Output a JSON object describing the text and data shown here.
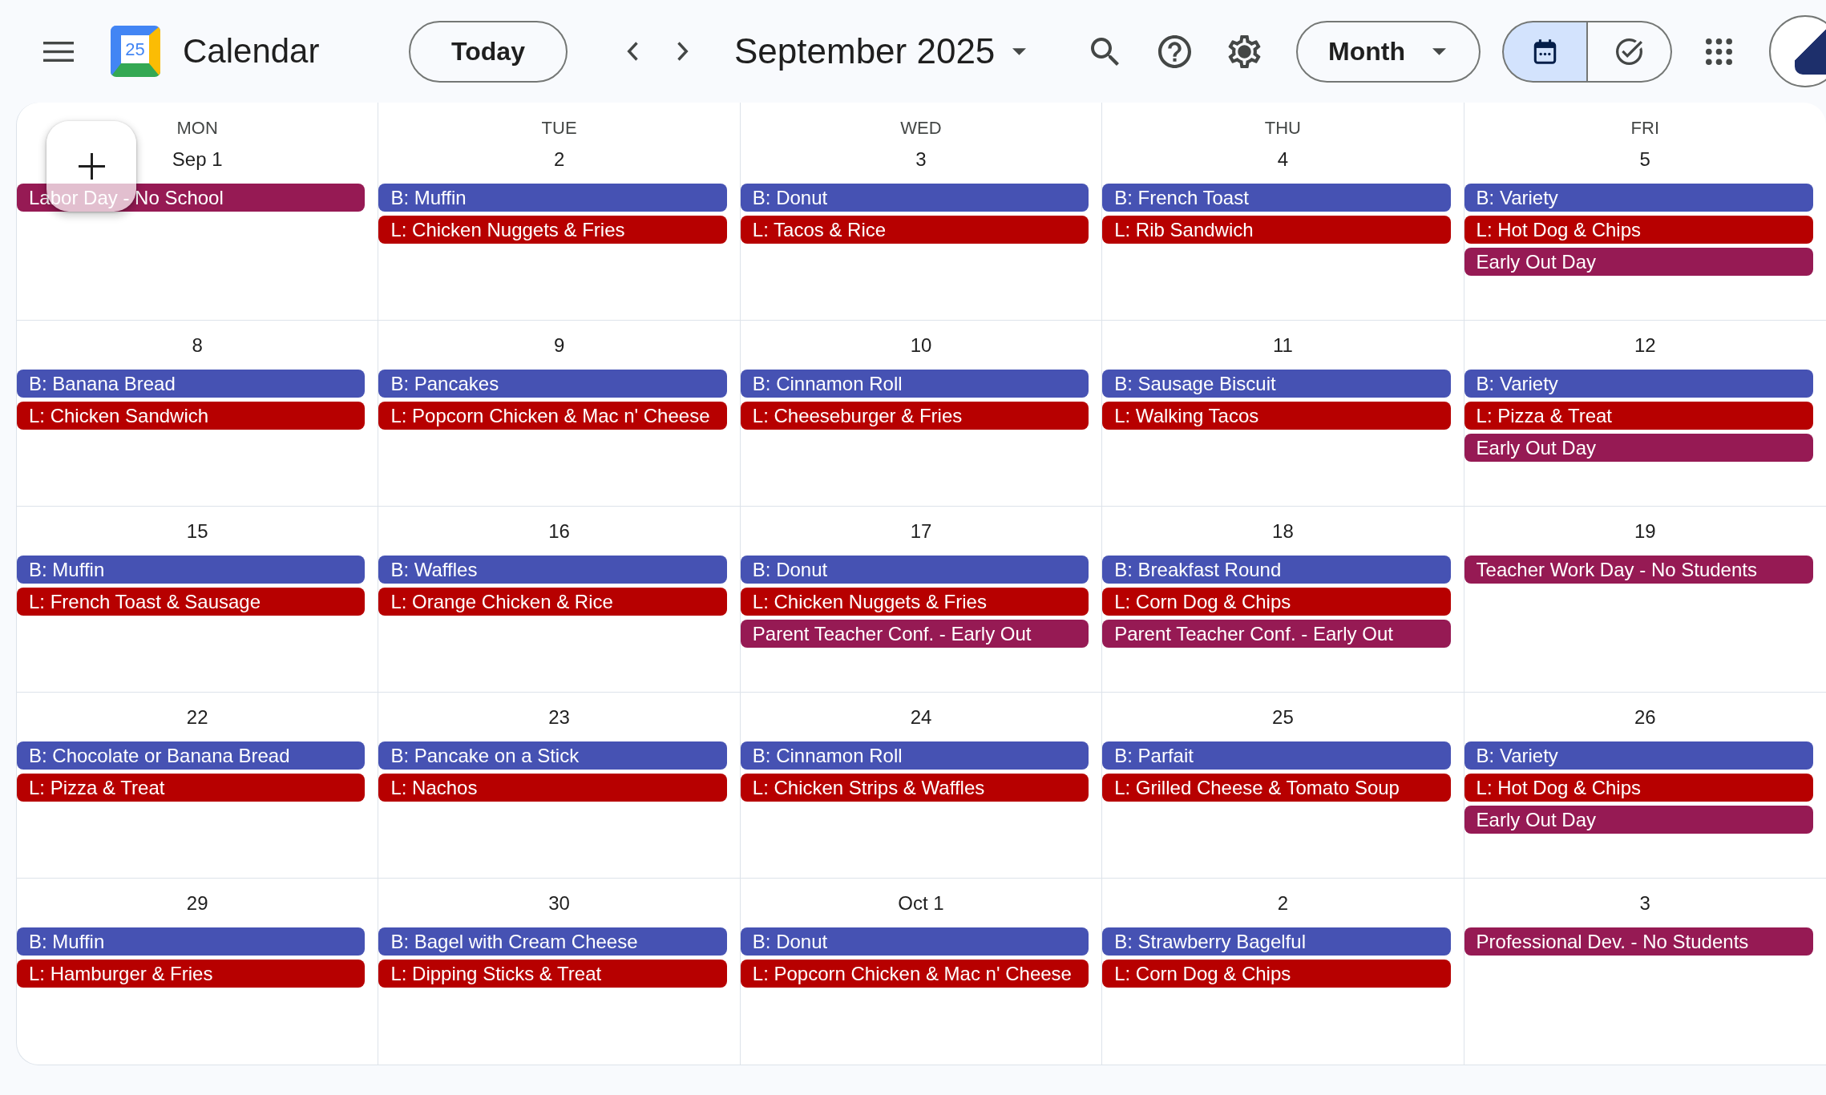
{
  "app": {
    "logo_text": "25",
    "title": "Calendar"
  },
  "toolbar": {
    "today_button": "Today",
    "period": "September 2025",
    "view_selector": "Month",
    "view_toggle": [
      {
        "kind": "calendar",
        "selected": true
      },
      {
        "kind": "tasks",
        "selected": false
      }
    ]
  },
  "weekdays": [
    "MON",
    "TUE",
    "WED",
    "THU",
    "FRI"
  ],
  "weeks": [
    {
      "days": [
        {
          "date": "Sep 1",
          "events": [
            {
              "title": "Labor Day - No School",
              "color": "#961a54"
            }
          ]
        },
        {
          "date": "2",
          "events": [
            {
              "title": "B: Muffin",
              "color": "#4652b3"
            },
            {
              "title": "L: Chicken Nuggets & Fries",
              "color": "#b70000"
            }
          ]
        },
        {
          "date": "3",
          "events": [
            {
              "title": "B: Donut",
              "color": "#4652b3"
            },
            {
              "title": "L: Tacos & Rice",
              "color": "#b70000"
            }
          ]
        },
        {
          "date": "4",
          "events": [
            {
              "title": "B: French Toast",
              "color": "#4652b3"
            },
            {
              "title": "L: Rib Sandwich",
              "color": "#b70000"
            }
          ]
        },
        {
          "date": "5",
          "events": [
            {
              "title": "B: Variety",
              "color": "#4652b3"
            },
            {
              "title": "L: Hot Dog & Chips",
              "color": "#b70000"
            },
            {
              "title": "Early Out Day",
              "color": "#961a54"
            }
          ]
        }
      ]
    },
    {
      "days": [
        {
          "date": "8",
          "events": [
            {
              "title": "B: Banana Bread",
              "color": "#4652b3"
            },
            {
              "title": "L: Chicken Sandwich",
              "color": "#b70000"
            }
          ]
        },
        {
          "date": "9",
          "events": [
            {
              "title": "B: Pancakes",
              "color": "#4652b3"
            },
            {
              "title": "L: Popcorn Chicken & Mac n' Cheese",
              "color": "#b70000"
            }
          ]
        },
        {
          "date": "10",
          "events": [
            {
              "title": "B: Cinnamon Roll",
              "color": "#4652b3"
            },
            {
              "title": "L: Cheeseburger & Fries",
              "color": "#b70000"
            }
          ]
        },
        {
          "date": "11",
          "events": [
            {
              "title": "B: Sausage Biscuit",
              "color": "#4652b3"
            },
            {
              "title": "L: Walking Tacos",
              "color": "#b70000"
            }
          ]
        },
        {
          "date": "12",
          "events": [
            {
              "title": "B: Variety",
              "color": "#4652b3"
            },
            {
              "title": "L: Pizza & Treat",
              "color": "#b70000"
            },
            {
              "title": "Early Out Day",
              "color": "#961a54"
            }
          ]
        }
      ]
    },
    {
      "days": [
        {
          "date": "15",
          "events": [
            {
              "title": "B: Muffin",
              "color": "#4652b3"
            },
            {
              "title": "L: French Toast & Sausage",
              "color": "#b70000"
            }
          ]
        },
        {
          "date": "16",
          "events": [
            {
              "title": "B: Waffles",
              "color": "#4652b3"
            },
            {
              "title": "L: Orange Chicken & Rice",
              "color": "#b70000"
            }
          ]
        },
        {
          "date": "17",
          "events": [
            {
              "title": "B: Donut",
              "color": "#4652b3"
            },
            {
              "title": "L: Chicken Nuggets & Fries",
              "color": "#b70000"
            },
            {
              "title": "Parent Teacher Conf. - Early Out",
              "color": "#961a54"
            }
          ]
        },
        {
          "date": "18",
          "events": [
            {
              "title": "B: Breakfast Round",
              "color": "#4652b3"
            },
            {
              "title": "L: Corn Dog & Chips",
              "color": "#b70000"
            },
            {
              "title": "Parent Teacher Conf. - Early Out",
              "color": "#961a54"
            }
          ]
        },
        {
          "date": "19",
          "events": [
            {
              "title": "Teacher Work Day - No Students",
              "color": "#961a54"
            }
          ]
        }
      ]
    },
    {
      "days": [
        {
          "date": "22",
          "events": [
            {
              "title": "B: Chocolate or Banana Bread",
              "color": "#4652b3"
            },
            {
              "title": "L: Pizza & Treat",
              "color": "#b70000"
            }
          ]
        },
        {
          "date": "23",
          "events": [
            {
              "title": "B: Pancake on a Stick",
              "color": "#4652b3"
            },
            {
              "title": "L: Nachos",
              "color": "#b70000"
            }
          ]
        },
        {
          "date": "24",
          "events": [
            {
              "title": "B: Cinnamon Roll",
              "color": "#4652b3"
            },
            {
              "title": "L: Chicken Strips & Waffles",
              "color": "#b70000"
            }
          ]
        },
        {
          "date": "25",
          "events": [
            {
              "title": "B: Parfait",
              "color": "#4652b3"
            },
            {
              "title": "L: Grilled Cheese & Tomato Soup",
              "color": "#b70000"
            }
          ]
        },
        {
          "date": "26",
          "events": [
            {
              "title": "B: Variety",
              "color": "#4652b3"
            },
            {
              "title": "L: Hot Dog & Chips",
              "color": "#b70000"
            },
            {
              "title": "Early Out Day",
              "color": "#961a54"
            }
          ]
        }
      ]
    },
    {
      "days": [
        {
          "date": "29",
          "events": [
            {
              "title": "B: Muffin",
              "color": "#4652b3"
            },
            {
              "title": "L: Hamburger & Fries",
              "color": "#b70000"
            }
          ]
        },
        {
          "date": "30",
          "events": [
            {
              "title": "B: Bagel with Cream Cheese",
              "color": "#4652b3"
            },
            {
              "title": "L: Dipping Sticks & Treat",
              "color": "#b70000"
            }
          ]
        },
        {
          "date": "Oct 1",
          "events": [
            {
              "title": "B: Donut",
              "color": "#4652b3"
            },
            {
              "title": "L: Popcorn Chicken & Mac n' Cheese",
              "color": "#b70000"
            }
          ]
        },
        {
          "date": "2",
          "events": [
            {
              "title": "B: Strawberry Bagelful",
              "color": "#4652b3"
            },
            {
              "title": "L: Corn Dog & Chips",
              "color": "#b70000"
            }
          ]
        },
        {
          "date": "3",
          "events": [
            {
              "title": "Professional Dev. - No Students",
              "color": "#961a54"
            }
          ]
        }
      ]
    }
  ]
}
